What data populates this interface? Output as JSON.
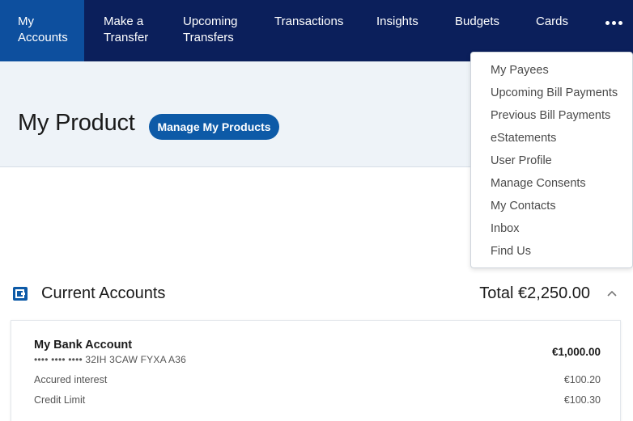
{
  "nav": {
    "items": [
      {
        "label": "My\nAccounts",
        "active": true
      },
      {
        "label": "Make a\nTransfer"
      },
      {
        "label": "Upcoming\nTransfers"
      },
      {
        "label": "Transactions"
      },
      {
        "label": "Insights"
      },
      {
        "label": "Budgets"
      },
      {
        "label": "Cards"
      }
    ],
    "more_icon": "more-horizontal-icon"
  },
  "hero": {
    "title": "My Product",
    "manage_button": "Manage My Products"
  },
  "dropdown": {
    "items": [
      "My Payees",
      "Upcoming Bill Payments",
      "Previous Bill Payments",
      "eStatements",
      "User Profile",
      "Manage Consents",
      "My Contacts",
      "Inbox",
      "Find Us"
    ]
  },
  "accounts_section": {
    "icon": "wallet-icon",
    "title": "Current Accounts",
    "total": "Total €2,250.00",
    "collapse_icon": "chevron-up-icon"
  },
  "account": {
    "name": "My Bank Account",
    "number": "•••• •••• •••• 32IH 3CAW FYXA A36",
    "balance": "€1,000.00",
    "rows": [
      {
        "label": "Accured interest",
        "value": "€100.20"
      },
      {
        "label": "Credit Limit",
        "value": "€100.30"
      }
    ]
  },
  "colors": {
    "nav_bg": "#0b1f5b",
    "nav_active": "#0d4f9e",
    "accent": "#0d5aa7",
    "hero_bg": "#eef3f8"
  }
}
